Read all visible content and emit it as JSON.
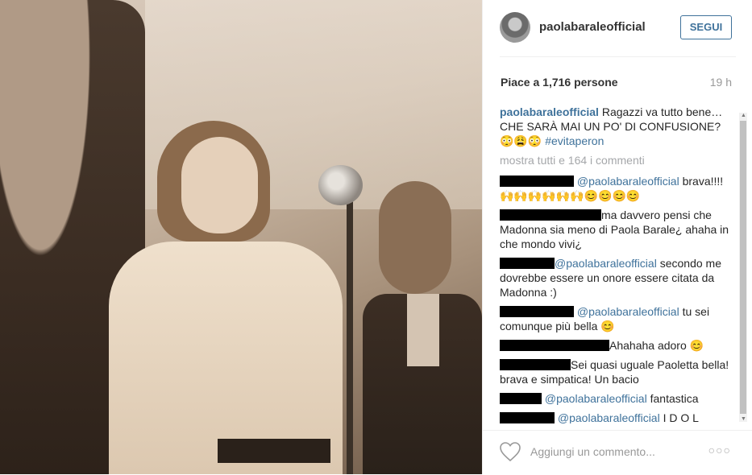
{
  "post": {
    "username": "paolabaraleofficial",
    "follow_label": "SEGUI",
    "likes": "Piace a 1,716 persone",
    "time": "19 h",
    "caption_user": "paolabaraleofficial",
    "caption_text": " Ragazzi va tutto bene… CHE SARÀ MAI UN PO' DI CONFUSIONE? 😳😩😳 ",
    "caption_tag": "#evitaperon",
    "more_comments": "mostra tutti e 164 i commenti"
  },
  "comments": [
    {
      "mention": "@paolabaraleofficial",
      "text": " brava!!!!🙌🙌🙌🙌🙌🙌😊😊😊😊"
    },
    {
      "mention": "",
      "text": "ma davvero pensi che Madonna sia meno di Paola Barale¿ ahaha in che mondo vivi¿"
    },
    {
      "mention": "@paolabaraleofficial",
      "text": " secondo me dovrebbe essere un onore essere citata da Madonna :)"
    },
    {
      "mention": "@paolabaraleofficial",
      "text": " tu sei comunque più bella 😊"
    },
    {
      "mention": "",
      "text": "Ahahaha adoro 😊"
    },
    {
      "mention": "",
      "text": "Sei quasi uguale Paoletta bella! brava e simpatica! Un bacio"
    },
    {
      "mention": "@paolabaraleofficial",
      "text": " fantastica"
    },
    {
      "mention": "@paolabaraleofficial",
      "text": " I D O L"
    }
  ],
  "footer": {
    "add_comment_placeholder": "Aggiungi un commento...",
    "more_dots": "○○○"
  },
  "icons": {
    "like": "heart-icon",
    "options": "more-options-icon"
  }
}
